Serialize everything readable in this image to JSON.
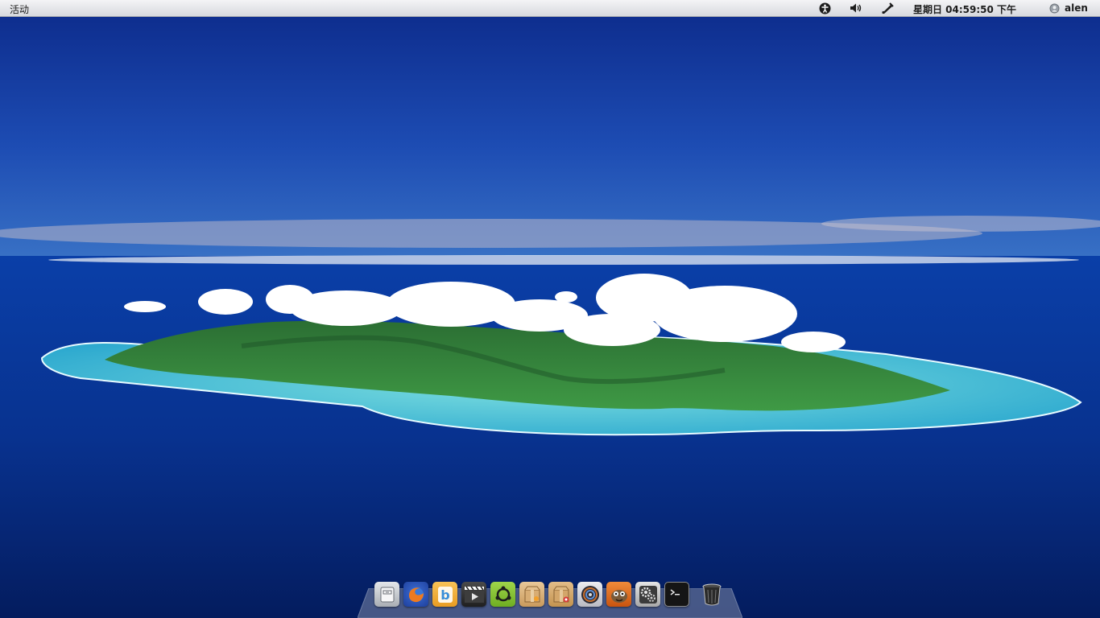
{
  "topbar": {
    "activities_label": "活动",
    "clock": "星期日 04:59:50 下午",
    "user_name": "alen",
    "tray": [
      {
        "name": "accessibility",
        "icon": "accessibility-icon"
      },
      {
        "name": "volume",
        "icon": "volume-icon"
      },
      {
        "name": "bluetooth",
        "icon": "bluetooth-icon"
      }
    ]
  },
  "dock": {
    "items": [
      {
        "app": "file-manager",
        "icon": "file-cabinet-icon",
        "color": "#c8ccd2"
      },
      {
        "app": "firefox",
        "icon": "firefox-icon",
        "color": "#e66a1f"
      },
      {
        "app": "blogger",
        "icon": "b-letter-icon",
        "color": "#f4b23c"
      },
      {
        "app": "video-player",
        "icon": "clapperboard-icon",
        "color": "#3a3a3a"
      },
      {
        "app": "ubuntu-software",
        "icon": "ubuntu-icon",
        "color": "#8cc63f"
      },
      {
        "app": "archive-manager",
        "icon": "package-icon",
        "color": "#d9b27c"
      },
      {
        "app": "package-installer",
        "icon": "package-install-icon",
        "color": "#d3a86c"
      },
      {
        "app": "disk-burner",
        "icon": "disc-icon",
        "color": "#d9d9de"
      },
      {
        "app": "gimp",
        "icon": "gimp-icon",
        "color": "#e06b1a"
      },
      {
        "app": "system-settings",
        "icon": "gears-icon",
        "color": "#dcdcdc"
      },
      {
        "app": "terminal",
        "icon": "terminal-icon",
        "color": "#1d1d1d"
      },
      {
        "app": "trash",
        "icon": "trash-icon",
        "color": "#2b2b2b"
      }
    ]
  },
  "colors": {
    "sky_top": "#0f2e92",
    "sky_horizon": "#3c72c9",
    "sea": "#08318f",
    "lagoon": "#47c6d6",
    "island": "#2f7d3a"
  }
}
